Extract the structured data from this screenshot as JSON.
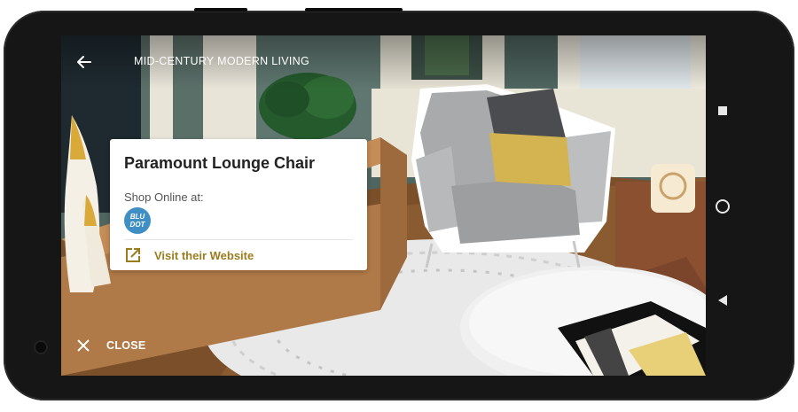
{
  "header": {
    "title": "MID-CENTURY MODERN LIVING",
    "back_icon": "arrow-left-icon"
  },
  "product_card": {
    "name": "Paramount Lounge Chair",
    "shop_label": "Shop Online at:",
    "vendor_logo_text": "BLU DOT",
    "visit_icon": "open-external-icon",
    "visit_label": "Visit their Website"
  },
  "footer": {
    "close_icon": "close-icon",
    "close_label": "CLOSE"
  },
  "system_nav": {
    "recents_icon": "square-icon",
    "home_icon": "circle-icon",
    "back_icon": "triangle-back-icon"
  },
  "colors": {
    "accent_gold": "#9b7d1f",
    "vendor_blue": "#3f8fc4",
    "phone_body": "#161616"
  }
}
